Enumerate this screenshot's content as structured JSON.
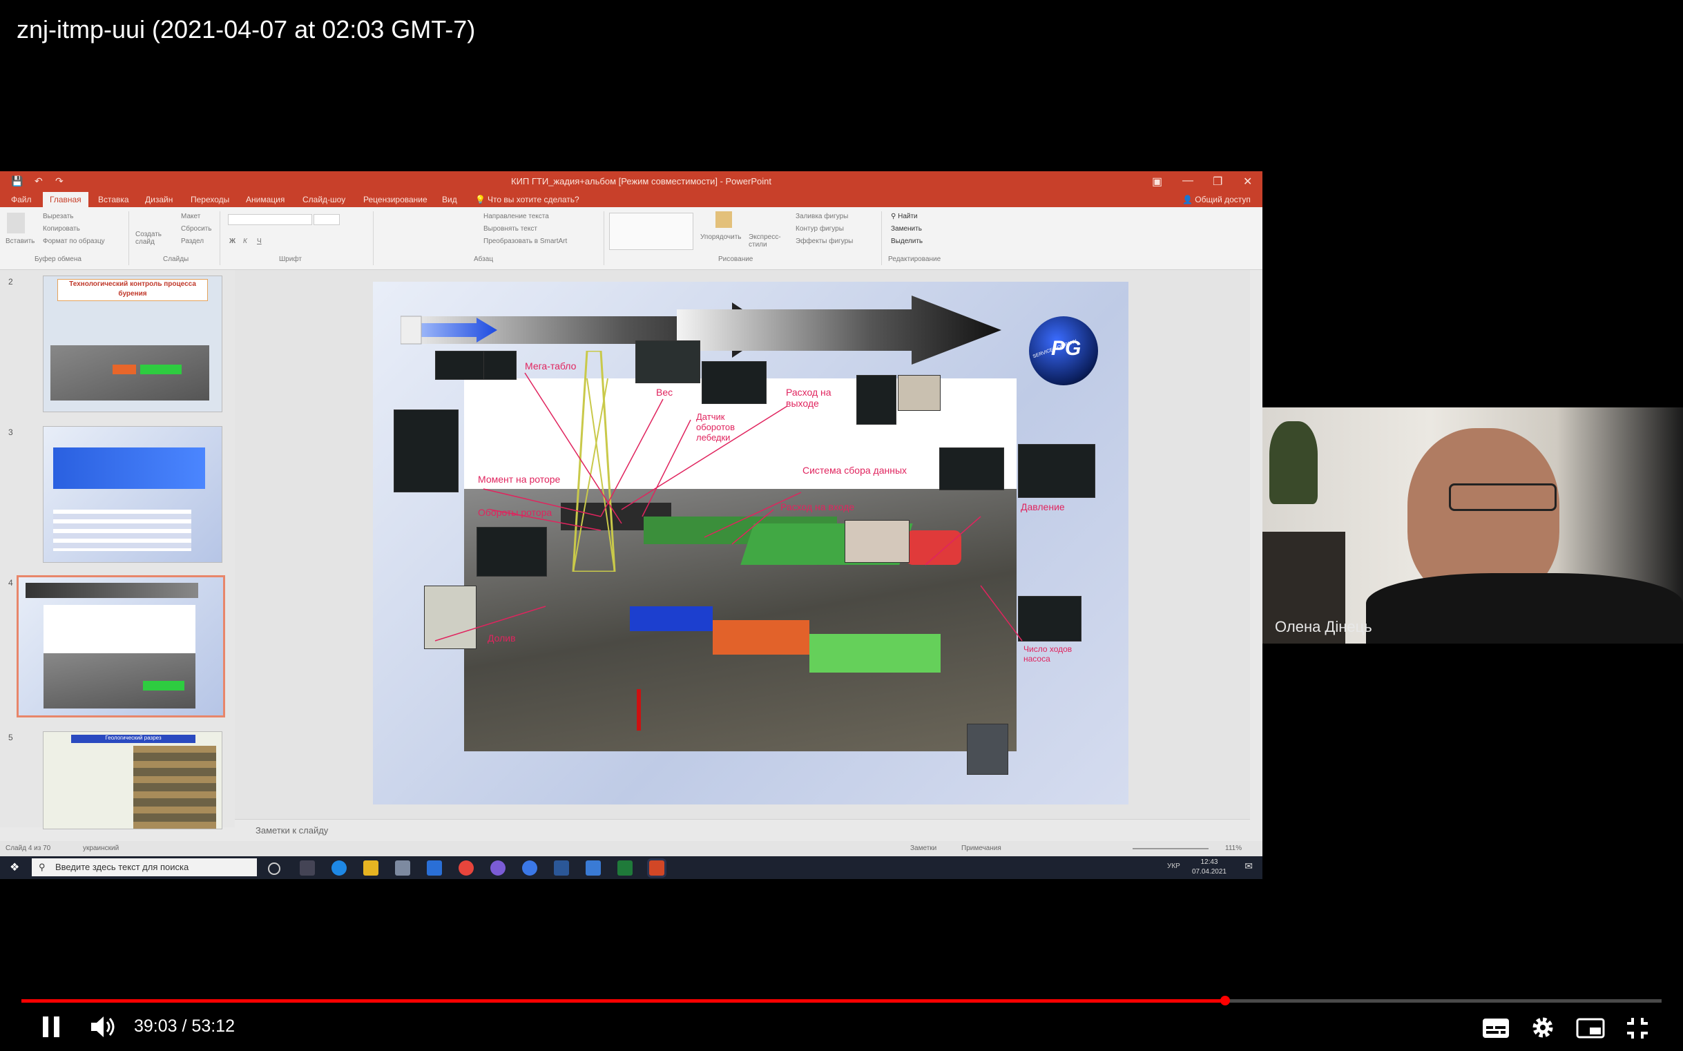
{
  "video": {
    "title": "znj-itmp-uui (2021-04-07 at 02:03 GMT-7)",
    "current_time": "39:03",
    "separator": "/",
    "duration": "53:12",
    "progress_fraction": 0.734
  },
  "webcam": {
    "participant_name": "Олена Дінець"
  },
  "powerpoint": {
    "window_title": "КИП ГТИ_жадия+альбом [Режим совместимости] - PowerPoint",
    "tabs": [
      "Файл",
      "Главная",
      "Вставка",
      "Дизайн",
      "Переходы",
      "Анимация",
      "Слайд-шоу",
      "Рецензирование",
      "Вид"
    ],
    "active_tab": "Главная",
    "tell_me": "Что вы хотите сделать?",
    "share": "Общий доступ",
    "ribbon": {
      "clipboard": {
        "paste": "Вставить",
        "cut": "Вырезать",
        "copy": "Копировать",
        "format_painter": "Формат по образцу",
        "group": "Буфер обмена"
      },
      "slides": {
        "new_slide": "Создать слайд",
        "layout": "Макет",
        "reset": "Сбросить",
        "section": "Раздел",
        "group": "Слайды"
      },
      "font": {
        "group": "Шрифт"
      },
      "paragraph": {
        "text_direction": "Направление текста",
        "align_text": "Выровнять текст",
        "convert_smartart": "Преобразовать в SmartArt",
        "group": "Абзац"
      },
      "drawing": {
        "arrange": "Упорядочить",
        "quick_styles": "Экспресс-стили",
        "shape_fill": "Заливка фигуры",
        "shape_outline": "Контур фигуры",
        "shape_effects": "Эффекты фигуры",
        "group": "Рисование"
      },
      "editing": {
        "find": "Найти",
        "replace": "Заменить",
        "select": "Выделить",
        "group": "Редактирование"
      }
    },
    "thumbnails": [
      {
        "number": "2",
        "title": "Технологический контроль процесса бурения"
      },
      {
        "number": "3",
        "title": ""
      },
      {
        "number": "4",
        "title": ""
      },
      {
        "number": "5",
        "title": "Геологический разрез"
      }
    ],
    "slide_labels": {
      "mega_tablo": "Мега-табло",
      "ves": "Вес",
      "datchik": "Датчик оборотов лебедки",
      "rashod_vyhod": "Расход на выходе",
      "moment": "Момент на роторе",
      "sistema": "Система сбора данных",
      "oboroty": "Обороты ротора",
      "rashod_vhod": "Расход на входе",
      "davlenie": "Давление",
      "dolya": "Долив",
      "chislo": "Число ходов насоса",
      "logo": "PG",
      "logo_sub": "SERVICE COMPANY"
    },
    "notes_placeholder": "Заметки к слайду",
    "status": {
      "slide_of": "Слайд 4 из 70",
      "language": "украинский",
      "notes": "Заметки",
      "comments": "Примечания",
      "zoom": "111%"
    },
    "taskbar": {
      "search_placeholder": "Введите здесь текст для поиска",
      "lang": "УКР",
      "time": "12:43",
      "date": "07.04.2021"
    }
  }
}
